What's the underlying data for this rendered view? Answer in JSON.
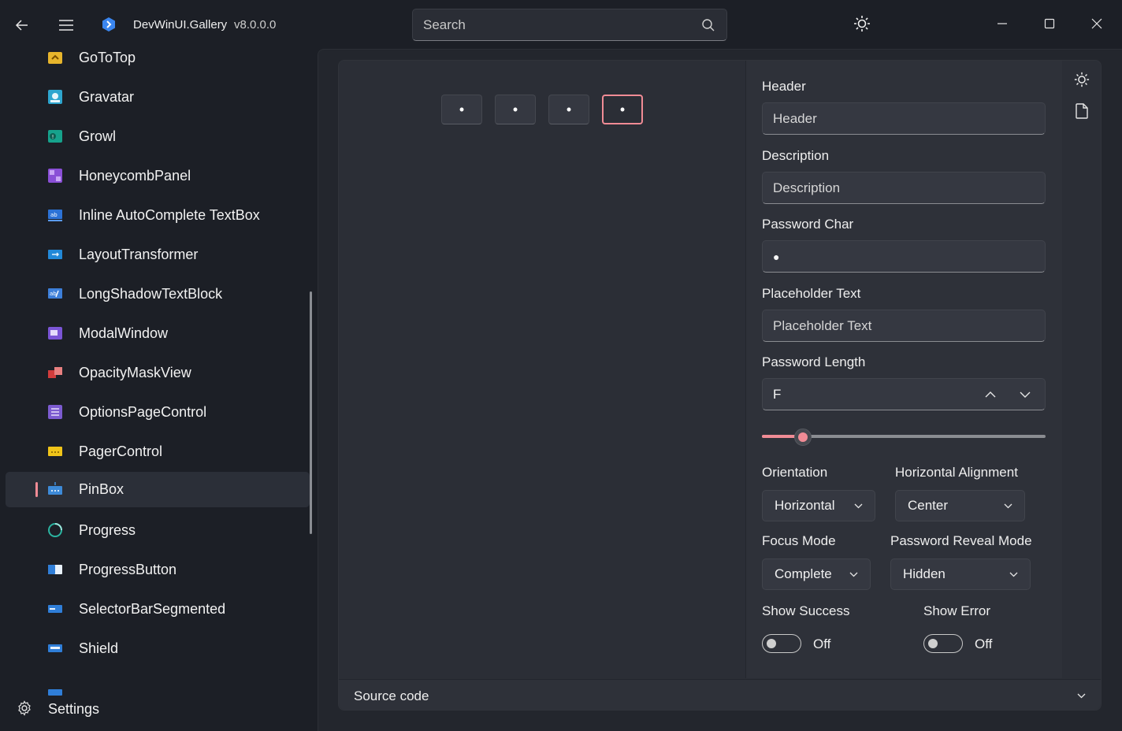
{
  "app": {
    "title": "DevWinUI.Gallery",
    "version": "v8.0.0.0"
  },
  "search": {
    "placeholder": "Search"
  },
  "sidebar": {
    "items": [
      {
        "label": "GoToTop",
        "icon": "gototop-icon"
      },
      {
        "label": "Gravatar",
        "icon": "gravatar-icon"
      },
      {
        "label": "Growl",
        "icon": "growl-icon"
      },
      {
        "label": "HoneycombPanel",
        "icon": "honeycomb-icon"
      },
      {
        "label": "Inline AutoComplete TextBox",
        "icon": "autocomplete-icon"
      },
      {
        "label": "LayoutTransformer",
        "icon": "layout-transformer-icon"
      },
      {
        "label": "LongShadowTextBlock",
        "icon": "long-shadow-icon"
      },
      {
        "label": "ModalWindow",
        "icon": "modal-window-icon"
      },
      {
        "label": "OpacityMaskView",
        "icon": "opacity-mask-icon"
      },
      {
        "label": "OptionsPageControl",
        "icon": "options-page-icon"
      },
      {
        "label": "PagerControl",
        "icon": "pager-icon"
      },
      {
        "label": "PinBox",
        "icon": "pinbox-icon",
        "selected": true
      },
      {
        "label": "Progress",
        "icon": "progress-icon"
      },
      {
        "label": "ProgressButton",
        "icon": "progress-button-icon"
      },
      {
        "label": "SelectorBarSegmented",
        "icon": "selector-bar-icon"
      },
      {
        "label": "Shield",
        "icon": "shield-icon"
      }
    ],
    "settings_label": "Settings"
  },
  "pinbox": {
    "char": "•",
    "length": 4,
    "focused_index": 3
  },
  "options": {
    "header": {
      "label": "Header",
      "placeholder": "Header"
    },
    "description": {
      "label": "Description",
      "placeholder": "Description"
    },
    "password_char": {
      "label": "Password Char",
      "value": "●"
    },
    "placeholder_text": {
      "label": "Placeholder Text",
      "placeholder": "Placeholder Text"
    },
    "password_length": {
      "label": "Password Length",
      "value": "F",
      "slider_fraction": 0.145
    },
    "orientation": {
      "label": "Orientation",
      "value": "Horizontal"
    },
    "horizontal_alignment": {
      "label": "Horizontal Alignment",
      "value": "Center"
    },
    "focus_mode": {
      "label": "Focus Mode",
      "value": "Complete"
    },
    "password_reveal_mode": {
      "label": "Password Reveal Mode",
      "value": "Hidden"
    },
    "show_success": {
      "label": "Show Success",
      "state": "Off"
    },
    "show_error": {
      "label": "Show Error",
      "state": "Off"
    }
  },
  "source": {
    "label": "Source code"
  },
  "colors": {
    "accent": "#f08b95",
    "background": "#1c1f26",
    "card": "#2b2e36"
  }
}
